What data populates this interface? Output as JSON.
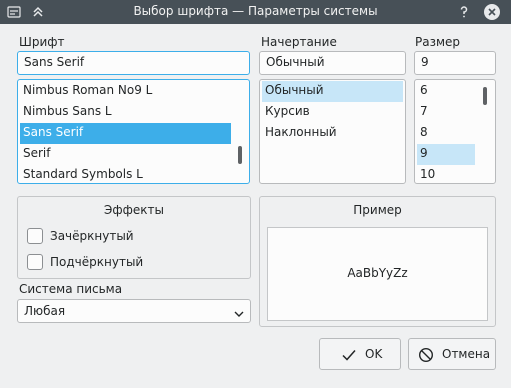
{
  "window": {
    "title": "Выбор шрифта — Параметры системы"
  },
  "font": {
    "label": "Шрифт",
    "value": "Sans Serif",
    "items": [
      "Nimbus Roman No9 L",
      "Nimbus Sans L",
      "Sans Serif",
      "Serif",
      "Standard Symbols L"
    ],
    "selected_index": 2
  },
  "style": {
    "label": "Начертание",
    "value": "Обычный",
    "items": [
      "Обычный",
      "Курсив",
      "Наклонный"
    ],
    "selected_index": 0
  },
  "size": {
    "label": "Размер",
    "value": "9",
    "items": [
      "6",
      "7",
      "8",
      "9",
      "10"
    ],
    "selected_index": 3
  },
  "effects": {
    "title": "Эффекты",
    "strikeout_label": "Зачёркнутый",
    "strikeout_checked": false,
    "underline_label": "Подчёркнутый",
    "underline_checked": false
  },
  "sample": {
    "title": "Пример",
    "text": "AaBbYyZz"
  },
  "writing_system": {
    "label": "Система письма",
    "value": "Любая"
  },
  "buttons": {
    "ok": "OK",
    "cancel": "Отмена"
  },
  "colors": {
    "accent": "#3daee9",
    "titlebar": "#475057",
    "background": "#eff0f1"
  }
}
